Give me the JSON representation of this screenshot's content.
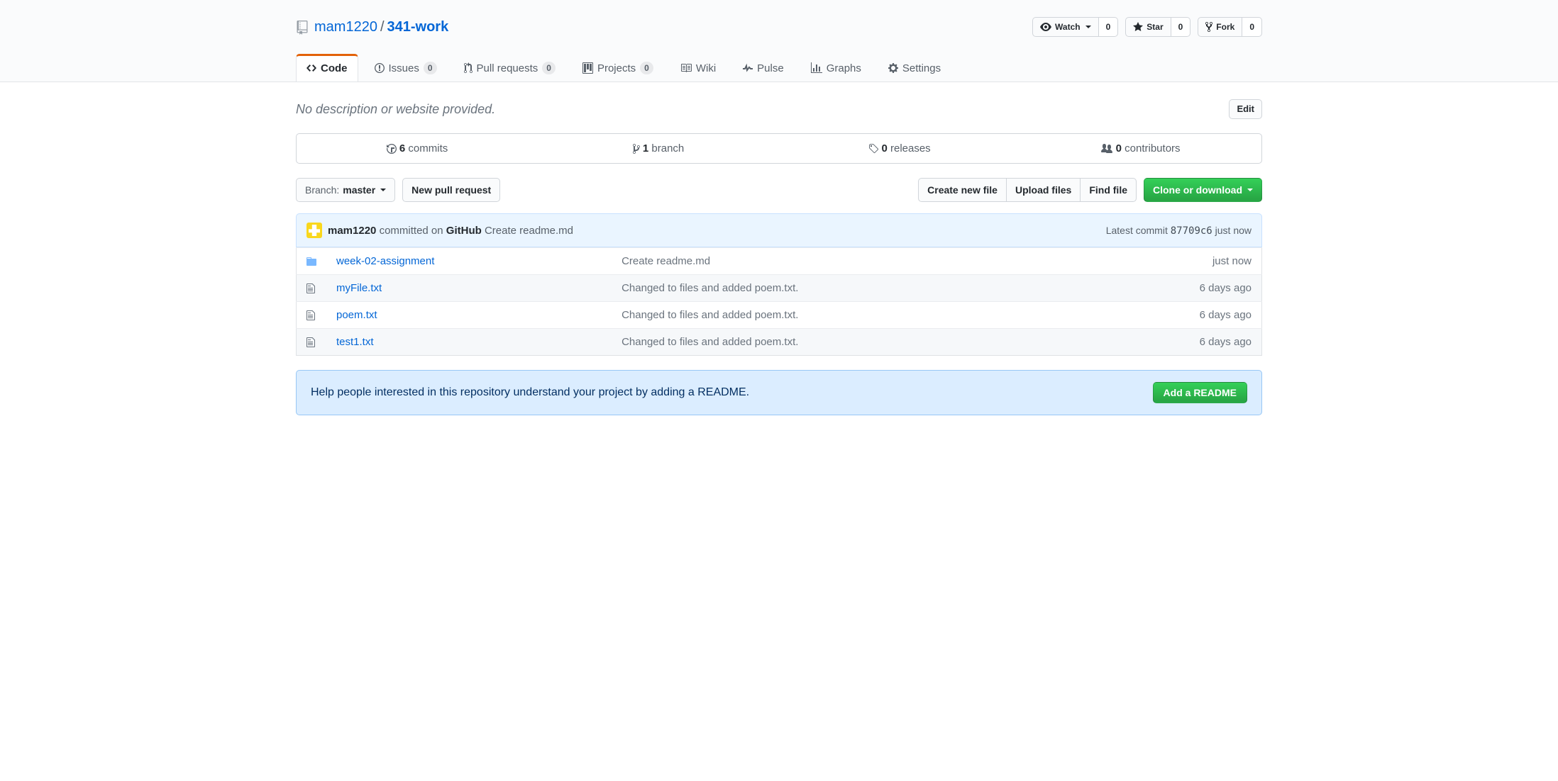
{
  "repo": {
    "owner": "mam1220",
    "name": "341-work",
    "separator": "/"
  },
  "actions": {
    "watch": {
      "label": "Watch",
      "count": "0"
    },
    "star": {
      "label": "Star",
      "count": "0"
    },
    "fork": {
      "label": "Fork",
      "count": "0"
    }
  },
  "tabs": {
    "code": "Code",
    "issues": {
      "label": "Issues",
      "count": "0"
    },
    "pulls": {
      "label": "Pull requests",
      "count": "0"
    },
    "projects": {
      "label": "Projects",
      "count": "0"
    },
    "wiki": "Wiki",
    "pulse": "Pulse",
    "graphs": "Graphs",
    "settings": "Settings"
  },
  "description": {
    "text": "No description or website provided.",
    "edit": "Edit"
  },
  "summary": {
    "commits": {
      "count": "6",
      "label": "commits"
    },
    "branches": {
      "count": "1",
      "label": "branch"
    },
    "releases": {
      "count": "0",
      "label": "releases"
    },
    "contributors": {
      "count": "0",
      "label": "contributors"
    }
  },
  "fileNav": {
    "branchPrefix": "Branch:",
    "branchName": "master",
    "newPR": "New pull request",
    "createFile": "Create new file",
    "uploadFiles": "Upload files",
    "findFile": "Find file",
    "clone": "Clone or download"
  },
  "latestCommit": {
    "author": "mam1220",
    "action1": "committed on",
    "where": "GitHub",
    "message": "Create readme.md",
    "latestLabel": "Latest commit",
    "sha": "87709c6",
    "time": "just now"
  },
  "files": [
    {
      "type": "dir",
      "name": "week-02-assignment",
      "message": "Create readme.md",
      "age": "just now"
    },
    {
      "type": "file",
      "name": "myFile.txt",
      "message": "Changed to files and added poem.txt.",
      "age": "6 days ago"
    },
    {
      "type": "file",
      "name": "poem.txt",
      "message": "Changed to files and added poem.txt.",
      "age": "6 days ago"
    },
    {
      "type": "file",
      "name": "test1.txt",
      "message": "Changed to files and added poem.txt.",
      "age": "6 days ago"
    }
  ],
  "readmePrompt": {
    "text": "Help people interested in this repository understand your project by adding a README.",
    "button": "Add a README"
  }
}
